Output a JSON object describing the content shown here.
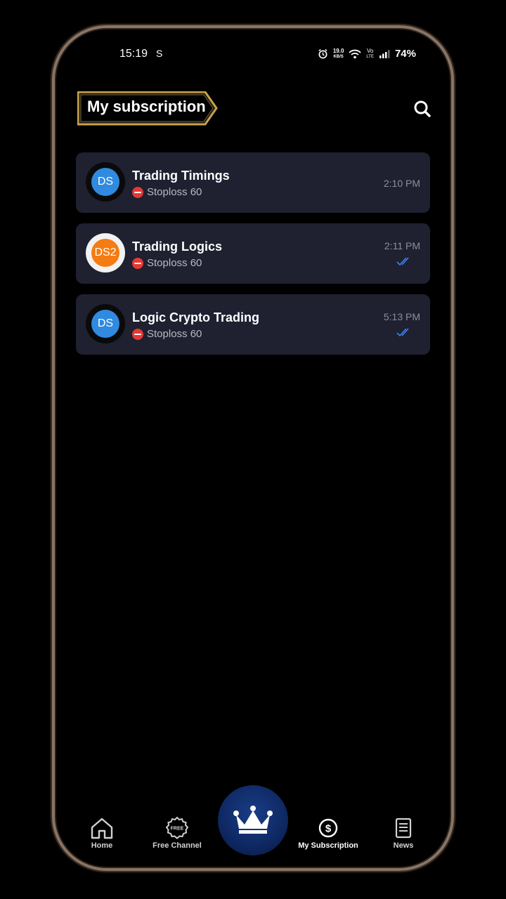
{
  "status_bar": {
    "time": "15:19",
    "s_icon": "S",
    "net_speed_value": "19.0",
    "net_speed_unit": "KB/S",
    "volte_top": "Vo",
    "volte_bottom": "LTE",
    "battery": "74%"
  },
  "header": {
    "title": "My subscription",
    "badge_border_color": "#c9a24a",
    "search_icon": "search-icon"
  },
  "subscriptions": [
    {
      "avatar_text": "DS",
      "avatar_color": "#2f8ae0",
      "name": "Trading Timings",
      "last_message": "Stoploss 60",
      "time": "2:10 PM",
      "read": false
    },
    {
      "avatar_text": "DS2",
      "avatar_color": "#f47c12",
      "name": "Trading Logics",
      "last_message": "Stoploss 60",
      "time": "2:11 PM",
      "read": true
    },
    {
      "avatar_text": "DS",
      "avatar_color": "#2f8ae0",
      "name": "Logic Crypto Trading",
      "last_message": "Stoploss 60",
      "time": "5:13 PM",
      "read": true
    }
  ],
  "bottom_nav": {
    "home": "Home",
    "free_channel": "Free Channel",
    "free_badge": "FREE",
    "my_subscription": "My Subscription",
    "news": "News",
    "crown_icon": "crown-icon",
    "accent": "#0f2a66"
  }
}
